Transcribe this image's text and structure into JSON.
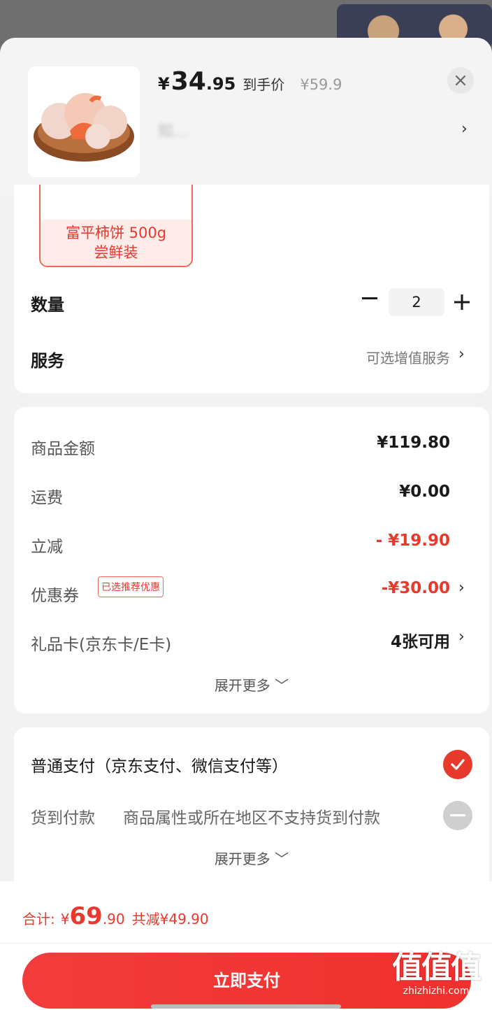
{
  "product": {
    "price_currency": "¥",
    "price_int": "34",
    "price_dec": ".95",
    "price_tag": "到手价",
    "original_price": "¥59.9",
    "spec_name_blurred": "知…",
    "sku_label_line1": "富平柿饼 500g",
    "sku_label_line2": "尝鲜装"
  },
  "options": {
    "quantity_label": "数量",
    "quantity_value": "2",
    "service_label": "服务",
    "service_value": "可选增值服务"
  },
  "fees": {
    "items": [
      {
        "label": "商品金额",
        "value": "¥119.80"
      },
      {
        "label": "运费",
        "value": "¥0.00"
      },
      {
        "label": "立减",
        "value": "- ¥19.90"
      },
      {
        "label": "优惠券",
        "value": "-¥30.00"
      },
      {
        "label": "礼品卡(京东卡/E卡)",
        "value": "4张可用"
      }
    ],
    "coupon_badge": "已选推荐优惠",
    "expand_label": "展开更多"
  },
  "payment": {
    "normal_label": "普通支付（京东支付、微信支付等）",
    "cod_label": "货到付款",
    "cod_note": "商品属性或所在地区不支持货到付款",
    "expand_label": "展开更多"
  },
  "footer": {
    "total_label": "合计:",
    "total_yen": "¥",
    "total_int": "69",
    "total_dec": ".90",
    "total_saved": "共减¥49.90",
    "pay_button": "立即支付"
  },
  "watermark": {
    "big": "值值值",
    "small": "zhizhizhi.com"
  },
  "colors": {
    "accent": "#e8392d",
    "sheet_bg": "#f2f2f2"
  }
}
